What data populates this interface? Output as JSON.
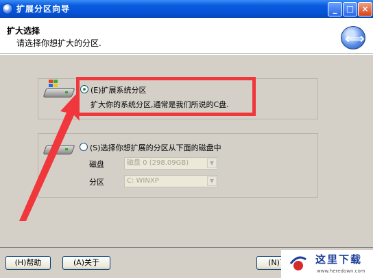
{
  "window": {
    "title": "扩展分区向导"
  },
  "header": {
    "title": "扩大选择",
    "subtitle": "请选择你想扩大的分区."
  },
  "option1": {
    "label": "(E)扩展系统分区",
    "description": "扩大你的系统分区,通常是我们所说的C盘.",
    "selected": true
  },
  "option2": {
    "label": "(S)选择你想扩展的分区从下面的磁盘中",
    "selected": false,
    "disk_label": "磁盘",
    "disk_value": "磁盘 0 (298.09GB)",
    "partition_label": "分区",
    "partition_value": "C: WINXP"
  },
  "buttons": {
    "help": "(H)帮助",
    "about": "(A)关于",
    "next": "(N)下"
  },
  "watermark": {
    "text": "这里下载",
    "url": "www.heredown.com"
  },
  "colors": {
    "titlebar": "#0553d6",
    "highlight": "#f0373c",
    "face": "#d4d0c8"
  }
}
